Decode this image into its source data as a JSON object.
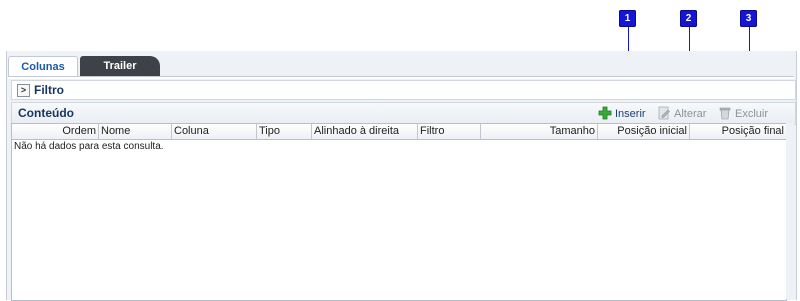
{
  "tabs": [
    {
      "label": "Colunas",
      "active": true
    },
    {
      "label": "Trailer",
      "active": false
    }
  ],
  "filter": {
    "label": "Filtro",
    "expand_symbol": ">"
  },
  "content": {
    "title": "Conteúdo",
    "actions": [
      {
        "label": "Inserir",
        "icon": "plus-icon",
        "enabled": true
      },
      {
        "label": "Alterar",
        "icon": "edit-icon",
        "enabled": false
      },
      {
        "label": "Excluir",
        "icon": "trash-icon",
        "enabled": false
      }
    ]
  },
  "grid": {
    "columns": [
      "Ordem",
      "Nome",
      "Coluna",
      "Tipo",
      "Alinhado à direita",
      "Filtro",
      "Tamanho",
      "Posição inicial",
      "Posição final"
    ],
    "empty_message": "Não há dados para esta consulta."
  },
  "callouts": [
    "1",
    "2",
    "3"
  ],
  "colors": {
    "accent": "#1515d8",
    "tab_active_text": "#1a5aa6",
    "tab_inactive_bg": "#3e4148",
    "insert_icon": "#3aa83a"
  }
}
